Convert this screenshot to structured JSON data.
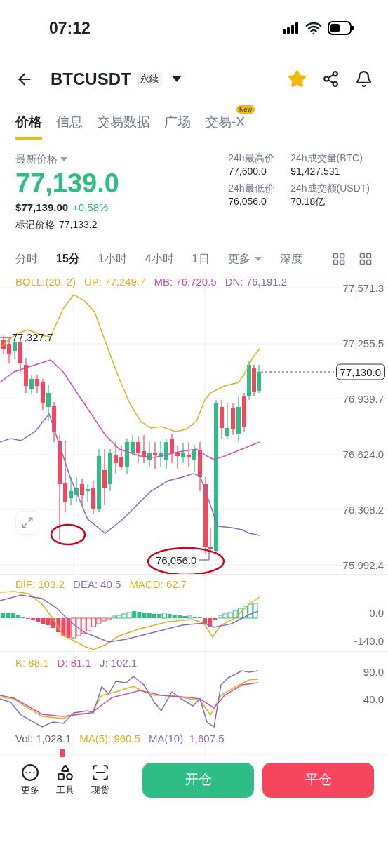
{
  "status_bar": {
    "time": "07:12"
  },
  "header": {
    "symbol": "BTCUSDT",
    "tag": "永续",
    "favorite": true
  },
  "tabs": [
    {
      "label": "价格",
      "selected": true
    },
    {
      "label": "信息",
      "selected": false
    },
    {
      "label": "交易数据",
      "selected": false
    },
    {
      "label": "广场",
      "selected": false
    },
    {
      "label": "交易-X",
      "selected": false,
      "badge": "New"
    }
  ],
  "price": {
    "label": "最新价格",
    "last": "77,139.0",
    "usd": "$77,139.00",
    "change": "+0.58%",
    "mark_label": "标记价格",
    "mark": "77,133.2"
  },
  "stats": [
    {
      "label": "24h最高价",
      "value": "77,600.0"
    },
    {
      "label": "24h成交量(BTC)",
      "value": "91,427.531"
    },
    {
      "label": "24h最低价",
      "value": "76,056.0"
    },
    {
      "label": "24h成交额(USDT)",
      "value": "70.18亿"
    }
  ],
  "intervals": [
    {
      "label": "分时",
      "selected": false
    },
    {
      "label": "15分",
      "selected": true
    },
    {
      "label": "1小时",
      "selected": false
    },
    {
      "label": "4小时",
      "selected": false
    },
    {
      "label": "1日",
      "selected": false
    },
    {
      "label": "更多",
      "selected": false,
      "dropdown": true
    },
    {
      "label": "深度",
      "selected": false
    }
  ],
  "main_chart": {
    "legend": [
      {
        "text": "BOLL:(20, 2)",
        "color": "#e0b020"
      },
      {
        "text": "UP: 77,249.7",
        "color": "#e0b020"
      },
      {
        "text": "MB: 76,720.5",
        "color": "#d04fb0"
      },
      {
        "text": "DN: 76,191.2",
        "color": "#8a6cc0"
      }
    ],
    "axis": [
      "77,571.3",
      "77,255.5",
      "76,939.7",
      "76,624.0",
      "76,308.2",
      "75,992.4"
    ],
    "current_price": "77,130.0",
    "high_marker": "77,327.7",
    "low_marker": "76,056.0"
  },
  "macd": {
    "legend": [
      {
        "text": "DIF: 103.2",
        "color": "#e0b020"
      },
      {
        "text": "DEA: 40.5",
        "color": "#8a6cc0"
      },
      {
        "text": "MACD: 62.7",
        "color": "#e0b020"
      }
    ],
    "axis": [
      "0.0",
      "-140.0"
    ]
  },
  "kdj": {
    "legend": [
      {
        "text": "K: 88.1",
        "color": "#e0b020"
      },
      {
        "text": "D: 81.1",
        "color": "#d04fb0"
      },
      {
        "text": "J: 102.1",
        "color": "#8a6cc0"
      }
    ],
    "axis": [
      "90.0",
      "40.0"
    ]
  },
  "volume": {
    "legend": [
      {
        "text": "Vol: 1,028.1",
        "color": "#666666"
      },
      {
        "text": "MA(5): 960.5",
        "color": "#e0b020"
      },
      {
        "text": "MA(10): 1,607.5",
        "color": "#8a6cc0"
      }
    ]
  },
  "actions": [
    {
      "label": "更多",
      "kind": "more"
    },
    {
      "label": "工具",
      "kind": "tools"
    },
    {
      "label": "现货",
      "kind": "spot"
    }
  ],
  "buttons": [
    {
      "label": "开仓",
      "kind": "open"
    },
    {
      "label": "平仓",
      "kind": "close"
    }
  ]
}
